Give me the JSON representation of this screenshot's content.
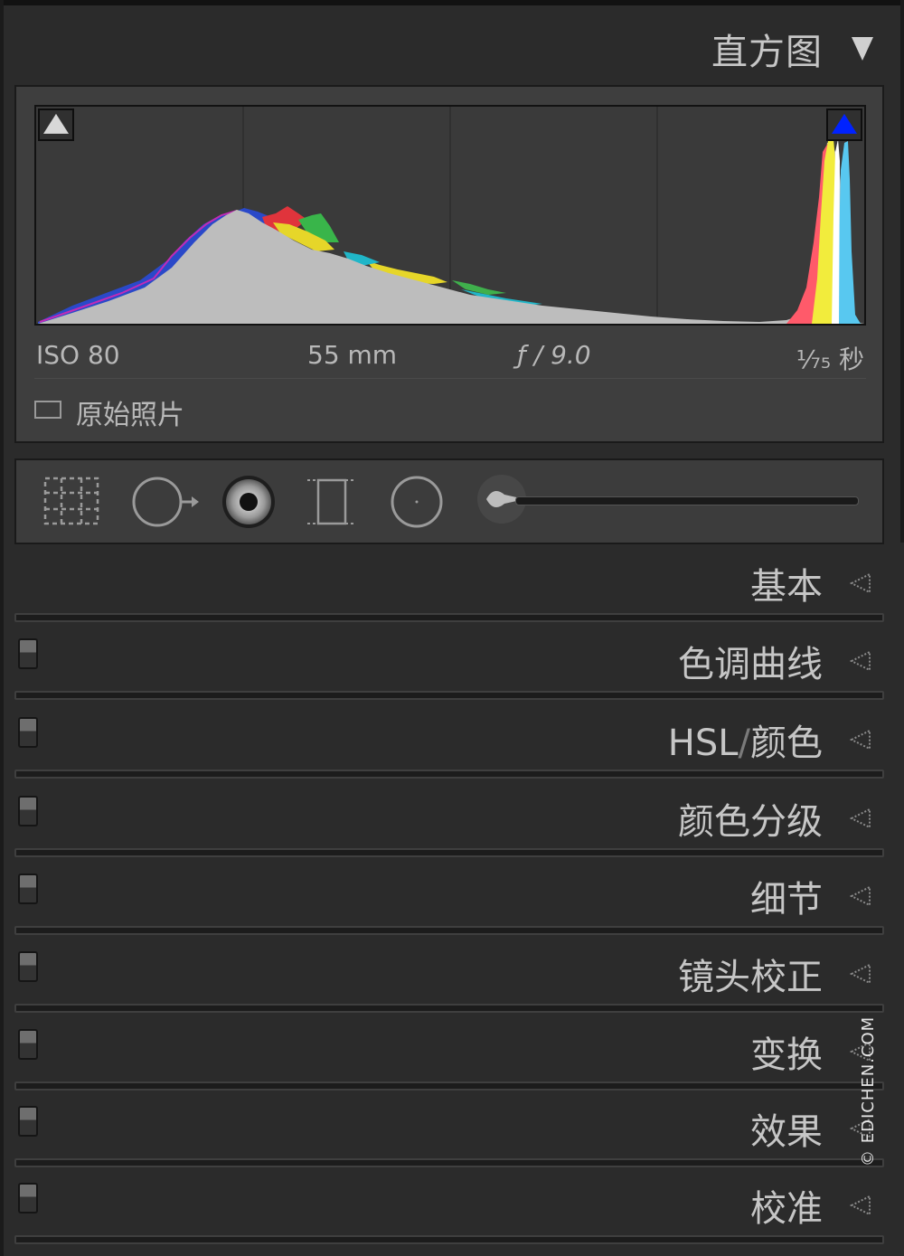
{
  "panel": {
    "title": "直方图",
    "collapse_icon": "triangle-down-icon"
  },
  "histogram": {
    "shadow_clipping_icon": "triangle-up-icon",
    "highlight_clipping_icon": "triangle-up-icon",
    "highlight_clipping_color": "#0022ff",
    "iso": "ISO 80",
    "focal_length": "55 mm",
    "aperture": "ƒ / 9.0",
    "shutter_speed": "⅟₇₅ 秒",
    "original_photo_label": "原始照片"
  },
  "toolbar": {
    "tools": [
      {
        "icon": "crop-overlay-icon"
      },
      {
        "icon": "spot-removal-icon"
      },
      {
        "icon": "red-eye-icon"
      },
      {
        "icon": "graduated-filter-icon"
      },
      {
        "icon": "radial-filter-icon"
      },
      {
        "icon": "adjustment-brush-icon"
      }
    ]
  },
  "sections": [
    {
      "label": "基本",
      "has_toggle": false
    },
    {
      "label": "色调曲线",
      "has_toggle": true
    },
    {
      "label_a": "HSL",
      "label_sep": "/",
      "label_b": "颜色",
      "has_toggle": true
    },
    {
      "label": "颜色分级",
      "has_toggle": true
    },
    {
      "label": "细节",
      "has_toggle": true
    },
    {
      "label": "镜头校正",
      "has_toggle": true
    },
    {
      "label": "变换",
      "has_toggle": true
    },
    {
      "label": "效果",
      "has_toggle": true
    },
    {
      "label": "校准",
      "has_toggle": true
    }
  ],
  "watermark": "© EDICHEN.COM"
}
